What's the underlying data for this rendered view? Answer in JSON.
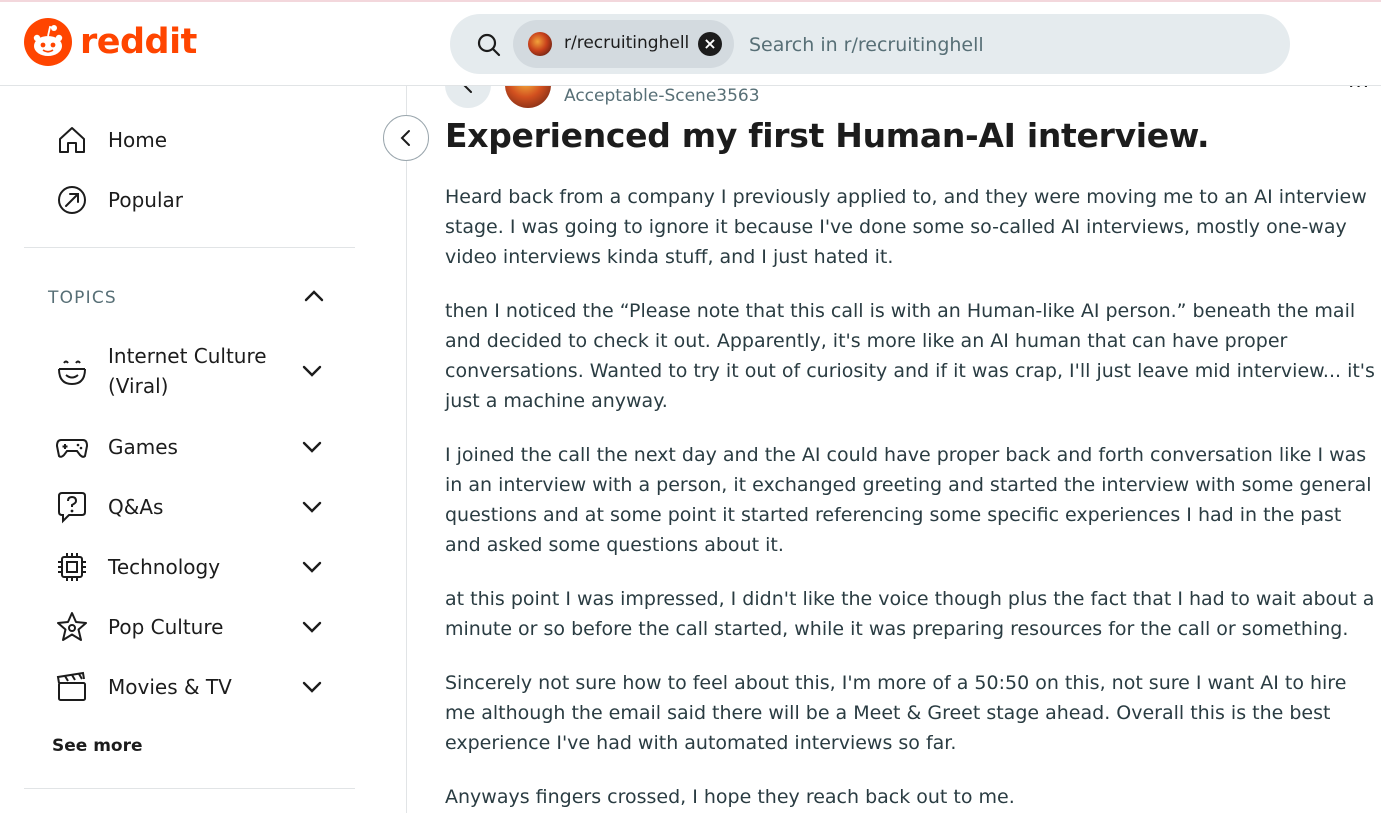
{
  "brand": {
    "name": "reddit",
    "color": "#ff4500"
  },
  "search": {
    "community_chip": "r/recruitinghell",
    "placeholder": "Search in r/recruitinghell"
  },
  "sidebar": {
    "nav": [
      {
        "label": "Home",
        "icon": "home-icon"
      },
      {
        "label": "Popular",
        "icon": "popular-icon"
      }
    ],
    "topics_header": "TOPICS",
    "topics": [
      {
        "label": "Internet Culture (Viral)",
        "icon": "smile-icon"
      },
      {
        "label": "Games",
        "icon": "gamepad-icon"
      },
      {
        "label": "Q&As",
        "icon": "question-icon"
      },
      {
        "label": "Technology",
        "icon": "chip-icon"
      },
      {
        "label": "Pop Culture",
        "icon": "star-icon"
      },
      {
        "label": "Movies & TV",
        "icon": "clapperboard-icon"
      }
    ],
    "see_more": "See more"
  },
  "post": {
    "author": "Acceptable-Scene3563",
    "title": "Experienced my first Human-AI interview.",
    "paragraphs": [
      "Heard back from a company I previously applied to, and they were moving me to an AI interview stage. I was going to ignore it because I've done some so-called AI interviews, mostly one-way video interviews kinda stuff, and I just hated it.",
      "then I noticed the “Please note that this call is with an Human-like AI person.” beneath the mail and decided to check it out. Apparently, it's more like an AI human that can have proper conversations. Wanted to try it out of curiosity and if it was crap, I'll just leave mid interview... it's just a machine anyway.",
      "I joined the call the next day and the AI could have proper back and forth conversation like I was in an interview with a person, it exchanged greeting and started the interview with some general questions and at some point it started referencing some specific experiences I had in the past and asked some questions about it.",
      "at this point I was impressed, I didn't like the voice though plus the fact that I had to wait about a minute or so before the call started, while it was preparing resources for the call or something.",
      "Sincerely not sure how to feel about this, I'm more of a 50:50 on this, not sure I want AI to hire me although the email said there will be a Meet & Greet stage ahead. Overall this is the best experience I've had with automated interviews so far.",
      "Anyways fingers crossed, I hope they reach back out to me."
    ]
  }
}
